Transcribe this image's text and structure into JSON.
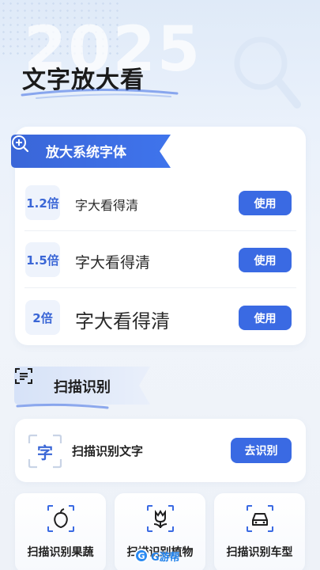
{
  "hero": {
    "year": "2025",
    "title": "文字放大看"
  },
  "zoom_section": {
    "title": "放大系统字体",
    "rows": [
      {
        "badge": "1.2倍",
        "sample": "字大看得清",
        "button": "使用"
      },
      {
        "badge": "1.5倍",
        "sample": "字大看得清",
        "button": "使用"
      },
      {
        "badge": "2倍",
        "sample": "字大看得清",
        "button": "使用"
      }
    ]
  },
  "scan_section": {
    "title": "扫描识别",
    "text_card": {
      "icon_char": "字",
      "label": "扫描识别文字",
      "button": "去识别"
    },
    "tiles": [
      {
        "label": "扫描识别果蔬",
        "icon": "fruit-icon"
      },
      {
        "label": "扫描识别植物",
        "icon": "plant-icon"
      },
      {
        "label": "扫描识别车型",
        "icon": "car-icon"
      }
    ]
  },
  "watermark": {
    "badge": "G",
    "text": "G游帮"
  },
  "colors": {
    "accent": "#3a6ae3",
    "badge_bg": "#eef3fc",
    "background": "#eef2f8"
  }
}
